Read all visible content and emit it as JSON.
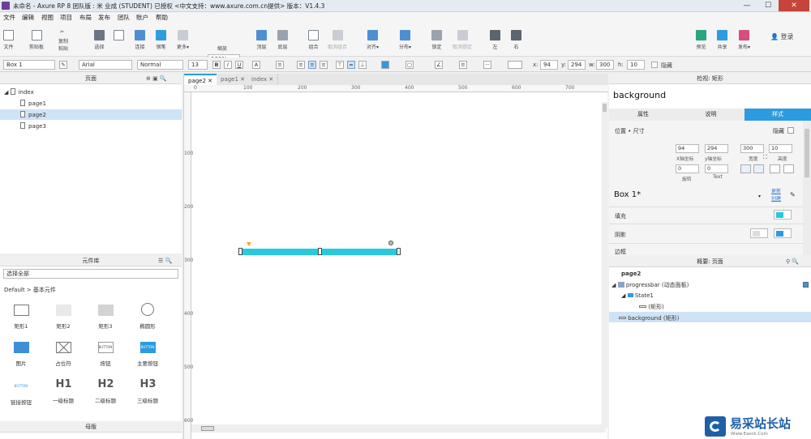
{
  "window": {
    "title": "未命名 - Axure RP 8 团队版 : 米 业成 (STUDENT) 已授权     <中文支持：www.axure.com.cn提供> 版本：V1.4.3",
    "min": "—",
    "max": "☐",
    "close": "✕"
  },
  "menu": [
    "文件",
    "编辑",
    "视图",
    "项目",
    "布局",
    "发布",
    "团队",
    "账户",
    "帮助"
  ],
  "toolbar": {
    "file": "文件",
    "clipboard": "剪贴板",
    "cut": "✂",
    "copy": "复制",
    "paste": "粘贴",
    "select": "选择",
    "connect": "连接",
    "pen": "钢笔",
    "more": "更多▾",
    "zoom_value": "100%",
    "zoom_label": "缩放",
    "top": "顶层",
    "bottom": "底层",
    "group": "组合",
    "ungroup": "取消组合",
    "align": "对齐▾",
    "distribute": "分布▾",
    "lock": "锁定",
    "unlock": "取消锁定",
    "left": "左",
    "right": "右",
    "preview": "预览",
    "share": "共享",
    "publish": "发布▾",
    "login": "登录"
  },
  "format": {
    "widget": "Box 1",
    "font": "Arial",
    "weight": "Normal",
    "size": "13",
    "bold": "B",
    "italic": "I",
    "underline": "U",
    "font_color": "A",
    "x_label": "x:",
    "x": "94",
    "y_label": "y:",
    "y": "294",
    "w_label": "w:",
    "w": "300",
    "h_label": "h:",
    "h": "10",
    "hidden": "隐藏"
  },
  "pages_panel": {
    "title": "页面",
    "items": [
      {
        "label": "index"
      },
      {
        "label": "page1"
      },
      {
        "label": "page2"
      },
      {
        "label": "page3"
      }
    ]
  },
  "library_panel": {
    "title": "元件库",
    "filter": "选择全部",
    "group": "Default > 基本元件",
    "widgets": [
      {
        "label": "矩形1"
      },
      {
        "label": "矩形2"
      },
      {
        "label": "矩形3"
      },
      {
        "label": "椭圆形"
      },
      {
        "label": "图片"
      },
      {
        "label": "占位符"
      },
      {
        "label": "按钮",
        "text": "BUTTON"
      },
      {
        "label": "主要按钮",
        "text": "BUTTON"
      },
      {
        "label": "链接按钮",
        "text": "BUTTON"
      },
      {
        "label": "一级标题",
        "text": "H1"
      },
      {
        "label": "二级标题",
        "text": "H2"
      },
      {
        "label": "三级标题",
        "text": "H3"
      }
    ]
  },
  "masters_panel": {
    "title": "母版"
  },
  "tabs": [
    "page2",
    "page1",
    "index"
  ],
  "ruler_h": [
    "0",
    "100",
    "200",
    "300",
    "400",
    "500",
    "600",
    "700"
  ],
  "ruler_v": [
    "100",
    "200",
    "300",
    "400",
    "500",
    "600"
  ],
  "inspector": {
    "title": "检视: 矩形",
    "name": "background",
    "tabs": [
      "属性",
      "说明",
      "样式"
    ],
    "position_size": "位置 • 尺寸",
    "hidden": "隐藏",
    "x": "94",
    "y": "294",
    "w": "300",
    "h": "10",
    "x_caption": "X轴坐标",
    "y_caption": "y轴坐标",
    "w_caption": "宽度",
    "h_caption": "高度",
    "rotate": "0",
    "text_rotate": "0",
    "rotate_caption": "旋转",
    "text_caption": "Text",
    "style_name": "Box 1*",
    "update": "更新",
    "create": "创建",
    "fill": "填充",
    "shadow": "阴影",
    "border": "边框"
  },
  "outline": {
    "title": "概要: 页面",
    "page": "page2",
    "items": [
      {
        "label": "progressbar (动态面板)"
      },
      {
        "label": "State1"
      },
      {
        "label": "(矩形)"
      },
      {
        "label": "background (矩形)"
      }
    ]
  },
  "colors": {
    "accent": "#2d9be0",
    "bar": "#28c9dc",
    "handle": "#f5a623"
  },
  "watermark": {
    "name": "易采站长站",
    "url": "Www.Easck.Com"
  }
}
